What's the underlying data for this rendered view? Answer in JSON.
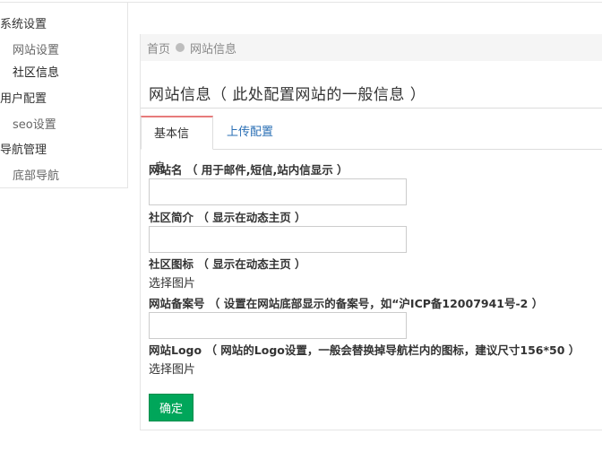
{
  "sidebar": {
    "groups": [
      {
        "label": "系统设置",
        "items": [
          "网站设置",
          "社区信息"
        ]
      },
      {
        "label": "用户配置",
        "items": [
          "seo设置"
        ]
      },
      {
        "label": "导航管理",
        "items": [
          "底部导航"
        ]
      }
    ],
    "active_item": "社区信息"
  },
  "breadcrumb": {
    "home": "首页",
    "current": "网站信息"
  },
  "page_title": "网站信息（ 此处配置网站的一般信息 ）",
  "tabs": [
    {
      "label": "基本信息",
      "active": true
    },
    {
      "label": "上传配置",
      "active": false
    }
  ],
  "form": {
    "site_name_label": "网站名 （ 用于邮件,短信,站内信显示 ）",
    "site_name_value": "",
    "intro_label": "社区简介 （ 显示在动态主页 ）",
    "intro_value": "",
    "icon_label": "社区图标 （ 显示在动态主页 ）",
    "icon_pick": "选择图片",
    "icp_label": "网站备案号 （ 设置在网站底部显示的备案号，如“沪ICP备12007941号-2 ）",
    "icp_value": "",
    "logo_label": "网站Logo （ 网站的Logo设置，一般会替换掉导航栏内的图标，建议尺寸156*50 ）",
    "logo_pick": "选择图片",
    "submit_label": "确定"
  },
  "colors": {
    "tab_accent": "#e77b7b",
    "link": "#2a6fb5",
    "submit": "#00a65a"
  }
}
